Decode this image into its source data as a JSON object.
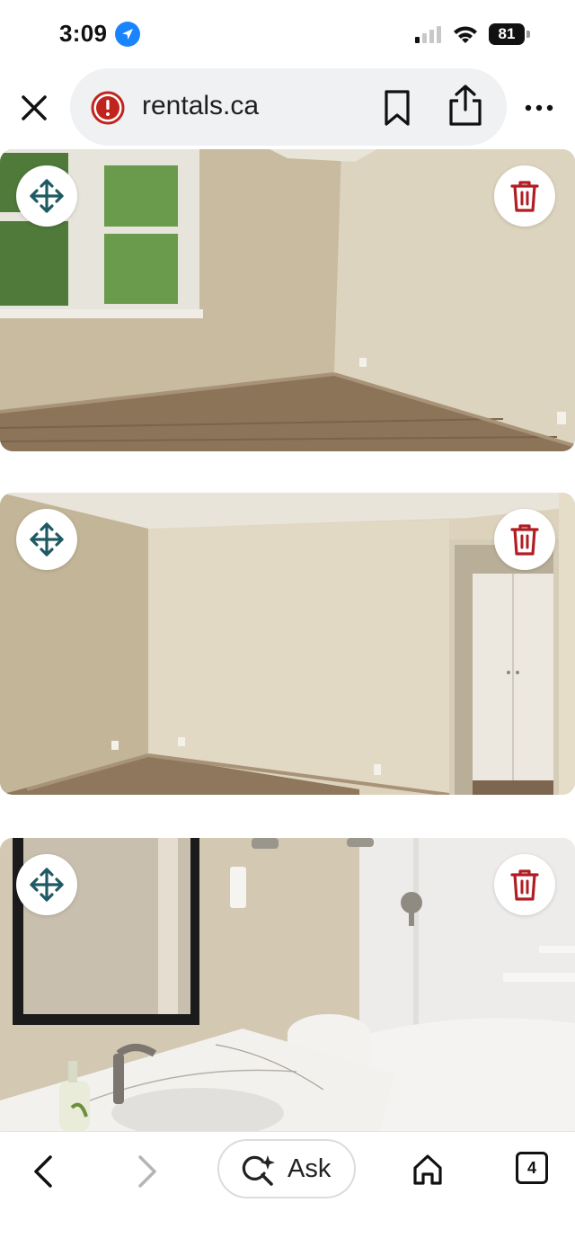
{
  "status_bar": {
    "time": "3:09",
    "battery": "81",
    "location_icon": "location-arrow-icon",
    "signal_icon": "cellular-signal-icon",
    "wifi_icon": "wifi-icon"
  },
  "browser": {
    "url": "rentals.ca",
    "security_icon": "warning-icon",
    "accent_warning_color": "#c0241c"
  },
  "photos": [
    {
      "subject": "empty room with window and laminate floor"
    },
    {
      "subject": "empty room with doorway and white closet"
    },
    {
      "subject": "bathroom with vanity, mirror, toilet and tub"
    }
  ],
  "photo_controls": {
    "move_icon": "move-arrows-icon",
    "delete_icon": "trash-icon",
    "move_color": "#1f5a63",
    "delete_color": "#b01e23"
  },
  "bottom_bar": {
    "ask_label": "Ask",
    "tabs_count": "4"
  }
}
